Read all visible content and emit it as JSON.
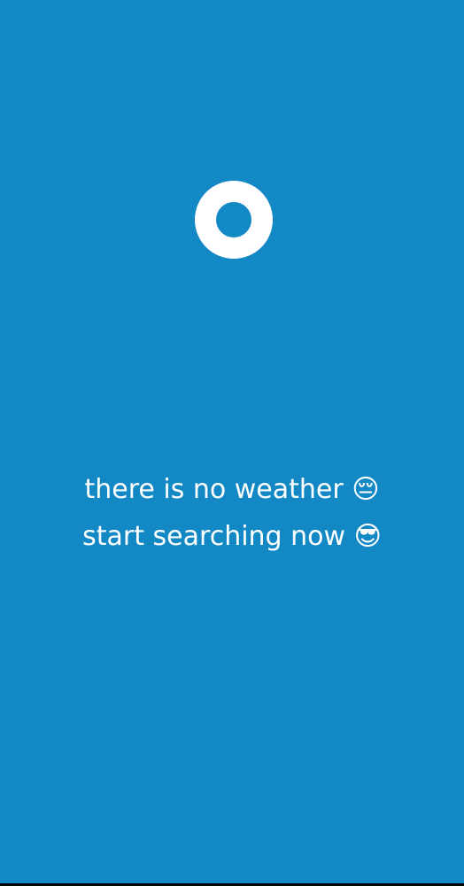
{
  "empty_state": {
    "icon": "ring-logo-icon",
    "line1": "there is no weather 😔",
    "line2": "start searching now 😎"
  },
  "colors": {
    "background": "#1288c5",
    "text": "#ffffff"
  }
}
